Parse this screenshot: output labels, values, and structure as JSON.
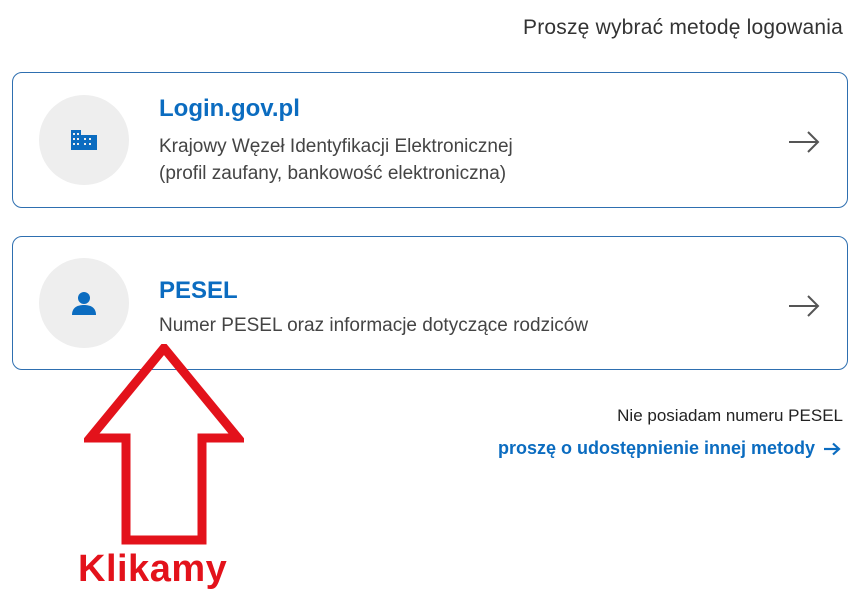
{
  "prompt": "Proszę wybrać metodę logowania",
  "methods": [
    {
      "title": "Login.gov.pl",
      "desc_line1": "Krajowy Węzeł Identyfikacji Elektronicznej",
      "desc_line2": "(profil zaufany, bankowość elektroniczna)",
      "icon": "building-icon"
    },
    {
      "title": "PESEL",
      "desc_line1": "Numer PESEL oraz informacje dotyczące rodziców",
      "icon": "person-icon"
    }
  ],
  "no_pesel": {
    "text": "Nie posiadam numeru PESEL",
    "link": "proszę o udostępnienie innej metody"
  },
  "annotation": {
    "text": "Klikamy",
    "color": "#e3121b"
  },
  "colors": {
    "accent": "#0b6cc0",
    "border": "#2e6fb0",
    "icon_bg": "#eeeeee"
  }
}
